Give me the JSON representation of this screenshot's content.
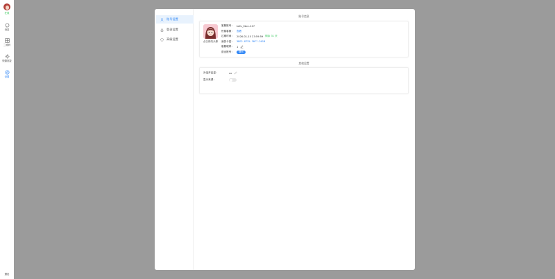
{
  "rail": {
    "status": "在线",
    "items": [
      {
        "label": "消息",
        "icon": "chat-icon"
      },
      {
        "label": "二维码",
        "icon": "qrcode-icon"
      },
      {
        "label": "快捷回复",
        "icon": "sparkle-icon"
      },
      {
        "label": "设置",
        "icon": "settings-icon"
      }
    ],
    "logout": "退出"
  },
  "menu": {
    "items": [
      {
        "label": "账号设置",
        "icon": "user-icon",
        "active": true
      },
      {
        "label": "登录设置",
        "icon": "lock-icon",
        "active": false
      },
      {
        "label": "高级设置",
        "icon": "shield-icon",
        "active": false
      }
    ]
  },
  "account": {
    "section_title": "账号信息",
    "avatar_caption": "点击修改头像",
    "rows": [
      {
        "key": "客服账号：",
        "value": "kefu_0bcc-107"
      },
      {
        "key": "所属客服：",
        "value": "查看"
      },
      {
        "key": "过期时间：",
        "value": "2026-01-15 23:59:59",
        "extra": "剩余 31 天"
      },
      {
        "key": "我的卡密：",
        "value": "3BE2-8735-F0F7-261B"
      },
      {
        "key": "客服昵称：",
        "value": "1"
      },
      {
        "key": "退出账号：",
        "value": "退出"
      }
    ]
  },
  "other": {
    "section_title": "其他设置",
    "rows": [
      {
        "key": "对话开启量：",
        "value": "xx"
      },
      {
        "key": "显示来源：",
        "value": ""
      }
    ]
  },
  "colors": {
    "accent": "#2f86f6",
    "online": "#34c759",
    "backdrop": "#9b9b9b"
  }
}
